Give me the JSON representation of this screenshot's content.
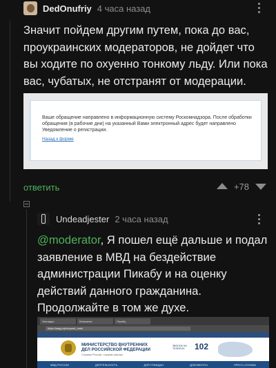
{
  "comment1": {
    "author": "DedOnufriy",
    "time": "4 часа назад",
    "text": "Значит пойдем другим путем, пока до вас, проукраинских модераторов, не дойдет что вы ходите по охуенно тонкому льду. Или пока вас, чубатых, не отстранят от модерации.",
    "image": {
      "text": "Ваше обращение направлено в информационную систему Роскомнадзора. После обработки обращения (в рабочие дни) на указанный Вами электронный адрес будет направлено Уведомление о регистрации.",
      "link": "Назад к форме"
    },
    "reply_label": "ответить",
    "rating": "+78"
  },
  "comment2": {
    "author": "Undeadjester",
    "time": "2 часа назад",
    "mention": "@moderator",
    "text": ", Я пошел ещё дальше и подал заявление в МВД на бездействие администрации Пикабу и на оценку действий данного гражданина. Продолжайте в том же духе.",
    "image": {
      "tabs": [
        "Закладки",
        "Внимание",
        "Пикабу"
      ],
      "url": "https://мвд.рф/request_main",
      "ministry": "МИНИСТЕРСТВО ВНУТРЕННИХ ДЕЛ РОССИЙСКОЙ ФЕДЕРАЦИИ",
      "ministry_sub": "Служим России, служим закону!",
      "phone_label": "ЗВОНОК НА ТЕЛЕФОН",
      "phone": "102",
      "nav": [
        "МВД РОССИИ",
        "ДЕЯТЕЛЬНОСТЬ",
        "ДЛЯ ГРАЖДАН",
        "ДОКУМЕНТЫ",
        "ПРЕСС-СЛУЖБА"
      ]
    }
  }
}
